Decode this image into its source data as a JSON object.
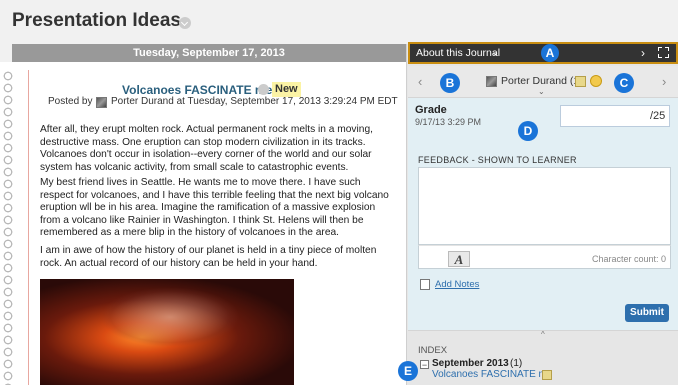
{
  "header": {
    "title": "Presentation Ideas"
  },
  "entry": {
    "date": "Tuesday, September 17, 2013",
    "title": "Volcanoes FASCINATE me",
    "badge": "New",
    "posted_prefix": "Posted by",
    "posted_author": "Porter Durand  at Tuesday, September 17, 2013 3:29:24 PM EDT",
    "paragraphs": [
      "After all, they erupt molten rock. Actual permanent rock melts in a moving, destructive mass. One eruption can stop modern civilization in its tracks. Volcanoes don't occur in isolation--every corner of the world and our solar system has volcanic activity, from small scale to catastrophic events.",
      "My best friend lives in Seattle. He wants me to move there. I have such respect for volcanoes, and I have this terrible feeling that the next big volcano eruption wll be in his area. Imagine the ramification of a massive explosion from a volcano like Rainier in Washington. I think St. Helens will then be remembered as a mere blip in the history of volcanoes in the area.",
      "I am in awe of how the history of our planet is held in a tiny piece of molten rock. An actual record of our history can be held in your hand."
    ]
  },
  "sidebar": {
    "journal_label": "About this Journal",
    "journal_caret": "⌄",
    "journal_arrow": "›",
    "markers": {
      "a": "A",
      "b": "B",
      "c": "C",
      "d": "D",
      "e": "E"
    },
    "user": {
      "name": "Porter Durand (1)",
      "prev": "‹",
      "next": "›",
      "caret": "⌄"
    },
    "grade": {
      "label": "Grade",
      "date": "9/17/13 3:29 PM",
      "max": "/25"
    },
    "feedback": {
      "label": "FEEDBACK - SHOWN TO LEARNER",
      "format_label": "A",
      "char_count": "Character count: 0"
    },
    "add_notes": "Add Notes",
    "submit": "Submit",
    "collapse_caret": "^",
    "index": {
      "label": "INDEX",
      "toggle": "−",
      "month": "September 2013",
      "count": "(1)",
      "entry": "Volcanoes FASCINATE me"
    }
  }
}
